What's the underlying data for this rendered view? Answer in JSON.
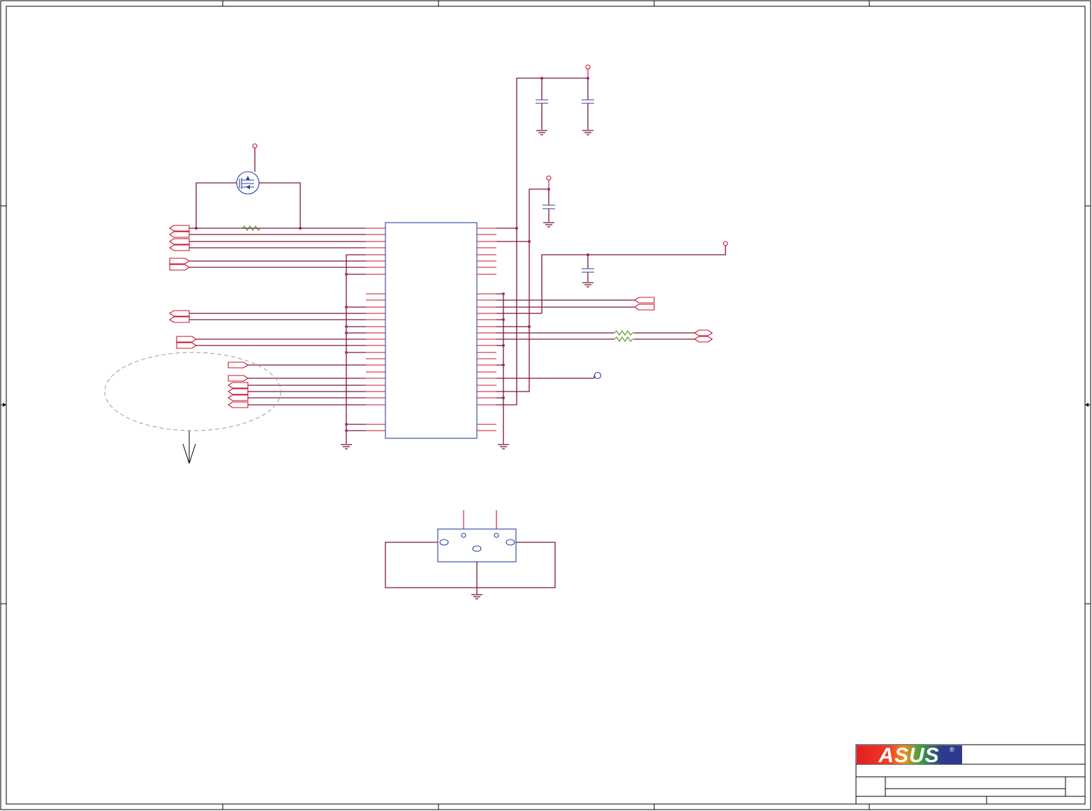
{
  "title_block": {
    "logo": "ASUS",
    "logo_mark": "®",
    "colors": {
      "red": "#e31e24",
      "orange": "#f28c1e",
      "green": "#3da33a",
      "blue": "#2e3a8c"
    }
  },
  "icons": {
    "mosfet": "mosfet-icon",
    "resistor": "resistor-icon",
    "capacitor": "capacitor-icon",
    "ground": "ground-icon",
    "offpage_connector": "offpage-connector-icon",
    "test_point": "test-point-icon",
    "arrow": "arrow-down-icon"
  },
  "colors": {
    "wire": "#7a1638",
    "pin": "#c8102e",
    "component": "#2b3f9e",
    "junction": "#a0298c",
    "resistor": "#5aa02c"
  }
}
